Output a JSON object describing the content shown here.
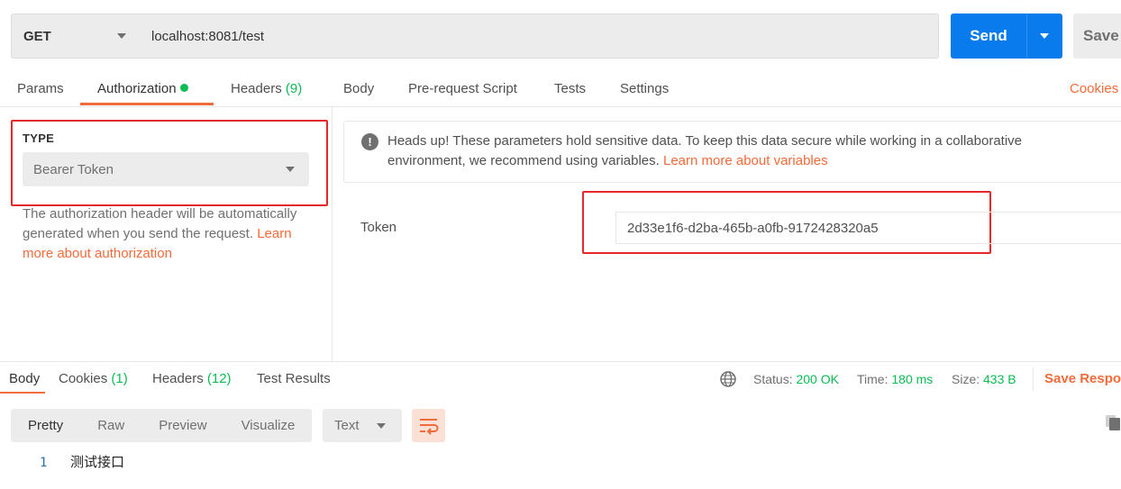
{
  "request": {
    "method": "GET",
    "url": "localhost:8081/test",
    "send_label": "Send",
    "save_label": "Save"
  },
  "tabs": {
    "params": "Params",
    "authorization": "Authorization",
    "headers": "Headers",
    "headers_count": "(9)",
    "body": "Body",
    "pre_request": "Pre-request Script",
    "tests": "Tests",
    "settings": "Settings",
    "cookies": "Cookies"
  },
  "auth": {
    "type_label": "TYPE",
    "type_value": "Bearer Token",
    "description": "The authorization header will be automatically generated when you send the request.",
    "learn_more": "Learn more about authorization",
    "info_text": "Heads up! These parameters hold sensitive data. To keep this data secure while working in a collaborative environment, we recommend using variables.",
    "info_link": "Learn more about variables",
    "token_label": "Token",
    "token_value": "2d33e1f6-d2ba-465b-a0fb-9172428320a5"
  },
  "response": {
    "tabs": {
      "body": "Body",
      "cookies": "Cookies",
      "cookies_count": "(1)",
      "headers": "Headers",
      "headers_count": "(12)",
      "test_results": "Test Results"
    },
    "status_label": "Status:",
    "status_value": "200 OK",
    "time_label": "Time:",
    "time_value": "180 ms",
    "size_label": "Size:",
    "size_value": "433 B",
    "save_response": "Save Response",
    "view_modes": [
      "Pretty",
      "Raw",
      "Preview",
      "Visualize"
    ],
    "format": "Text",
    "lines": [
      {
        "num": "1",
        "text": "测试接口"
      }
    ]
  },
  "colors": {
    "accent": "#f26b3a",
    "primary": "#097bed",
    "success": "#0cbb52",
    "highlight": "#e5292a"
  }
}
